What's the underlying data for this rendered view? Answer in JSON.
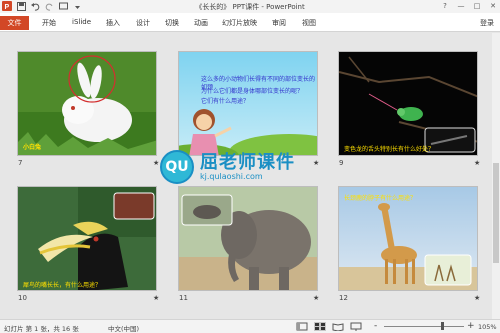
{
  "window": {
    "title": "《长长的》 PPT课件 - PowerPoint",
    "controls": [
      "?",
      "—",
      "□",
      "✕"
    ]
  },
  "ribbon": {
    "file_tab": "文件",
    "tabs": [
      "开始",
      "iSlide",
      "插入",
      "设计",
      "切换",
      "动画",
      "幻灯片放映",
      "审阅",
      "视图"
    ],
    "login": "登录"
  },
  "slides": [
    {
      "number": "7",
      "caption": "小白兔"
    },
    {
      "number": "8",
      "lines": [
        "这么多的小动物们长得有不同的部位变长的如颈",
        "为什么它们都是身体哪部位变长的呢？",
        "它们有什么用途？"
      ]
    },
    {
      "number": "9",
      "caption": "变色龙的舌头特别长有什么好处？"
    },
    {
      "number": "10",
      "caption": "犀鸟的嘴长长，有什么用途？"
    },
    {
      "number": "11"
    },
    {
      "number": "12",
      "caption": "长颈鹿的脖子有什么用途？"
    }
  ],
  "watermark": {
    "logo": "QU",
    "title": "屈老师课件",
    "url": "kj.qulaoshi.com"
  },
  "status": {
    "slide_info": "幻灯片 第 1 张，共 16 张",
    "language": "中文(中国)",
    "zoom": "105%",
    "zoom_minus": "-",
    "zoom_plus": "+"
  },
  "colors": {
    "accent": "#d24726",
    "watermark": "#1a8fc4"
  }
}
